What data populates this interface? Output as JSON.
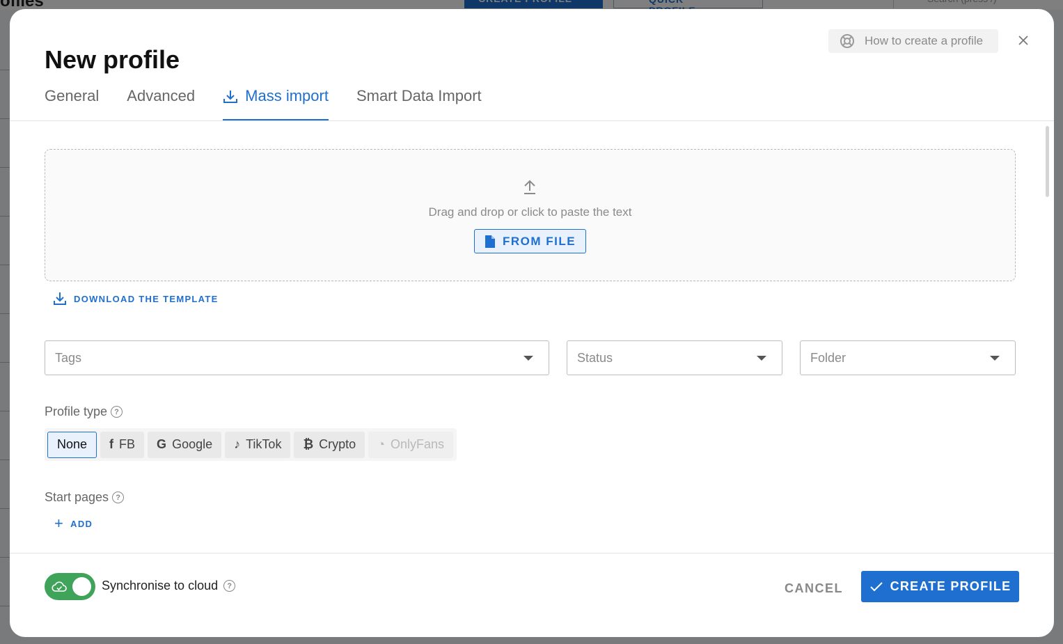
{
  "background": {
    "page_title": "ofiles",
    "create_button": "CREATE PROFILE",
    "quick_button": "QUICK PROFILE",
    "search_placeholder": "Search (press /)"
  },
  "modal": {
    "title": "New profile",
    "help_label": "How to create a profile",
    "tabs": [
      {
        "label": "General",
        "active": false
      },
      {
        "label": "Advanced",
        "active": false
      },
      {
        "label": "Mass import",
        "active": true,
        "icon": "download-icon"
      },
      {
        "label": "Smart Data Import",
        "active": false
      }
    ],
    "dropzone": {
      "icon": "upload-icon",
      "text": "Drag and drop or click to paste the text",
      "from_file_label": "FROM FILE"
    },
    "download_template_label": "DOWNLOAD THE TEMPLATE",
    "selects": {
      "tags_placeholder": "Tags",
      "status_placeholder": "Status",
      "folder_placeholder": "Folder"
    },
    "profile_type": {
      "label": "Profile type",
      "options": [
        {
          "label": "None",
          "icon": "",
          "state": "active"
        },
        {
          "label": "FB",
          "icon": "facebook-icon",
          "state": "normal"
        },
        {
          "label": "Google",
          "icon": "google-icon",
          "state": "normal"
        },
        {
          "label": "TikTok",
          "icon": "tiktok-icon",
          "state": "normal"
        },
        {
          "label": "Crypto",
          "icon": "bitcoin-icon",
          "state": "normal"
        },
        {
          "label": "OnlyFans",
          "icon": "onlyfans-icon",
          "state": "disabled"
        }
      ]
    },
    "start_pages": {
      "label": "Start pages",
      "add_label": "ADD"
    },
    "footer": {
      "sync_label": "Synchronise to cloud",
      "sync_enabled": true,
      "cancel_label": "CANCEL",
      "create_label": "CREATE PROFILE"
    }
  },
  "colors": {
    "accent": "#1e6fd0",
    "toggle_on": "#3fa45a"
  }
}
